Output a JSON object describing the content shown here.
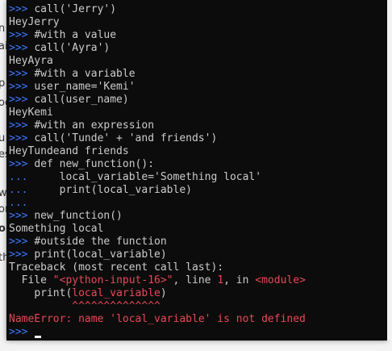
{
  "background_fragments": [
    "n",
    "ai",
    "p",
    "og",
    "u",
    "es",
    "wi",
    "on",
    "o",
    "th"
  ],
  "terminal": {
    "lines": [
      {
        "prompt": ">>> ",
        "text": "call('Jerry')"
      },
      {
        "prompt": "",
        "text": "HeyJerry"
      },
      {
        "prompt": ">>> ",
        "text": "#with a value"
      },
      {
        "prompt": ">>> ",
        "text": "call('Ayra')"
      },
      {
        "prompt": "",
        "text": "HeyAyra"
      },
      {
        "prompt": ">>> ",
        "text": "#with a variable"
      },
      {
        "prompt": ">>> ",
        "text": "user_name='Kemi'"
      },
      {
        "prompt": ">>> ",
        "text": "call(user_name)"
      },
      {
        "prompt": "",
        "text": "HeyKemi"
      },
      {
        "prompt": ">>> ",
        "text": "#with an expression"
      },
      {
        "prompt": ">>> ",
        "text": "call('Tunde' + 'and friends')"
      },
      {
        "prompt": "",
        "text": "HeyTundeand friends"
      },
      {
        "prompt": ">>> ",
        "text": "def new_function():"
      },
      {
        "prompt": "... ",
        "text": "    local_variable='Something local'"
      },
      {
        "prompt": "... ",
        "text": "    print(local_variable)"
      },
      {
        "prompt": "...",
        "text": ""
      },
      {
        "prompt": ">>> ",
        "text": "new_function()"
      },
      {
        "prompt": "",
        "text": "Something local"
      },
      {
        "prompt": ">>> ",
        "text": "#outside the function"
      },
      {
        "prompt": ">>> ",
        "text": "print(local_variable)"
      },
      {
        "prompt": "",
        "text": "Traceback (most recent call last):"
      }
    ],
    "traceback": {
      "file_prefix": "  File ",
      "file_name": "\"<python-input-16>\"",
      "line_sep": ", line ",
      "line_no": "1",
      "in_sep": ", in ",
      "module": "<module>",
      "code_indent": "    ",
      "code_pre": "print(",
      "code_hl": "local_variable",
      "code_post": ")",
      "caret_indent": "          ",
      "carets": "^^^^^^^^^^^^^^"
    },
    "error": {
      "cls": "NameError",
      "message": ": name 'local_variable' is not defined"
    },
    "final_prompt": ">>> ",
    "colors": {
      "background": "#0c0c0c",
      "foreground": "#cccccc",
      "prompt": "#3b78ff",
      "error": "#e74856",
      "module": "#e74856"
    }
  }
}
